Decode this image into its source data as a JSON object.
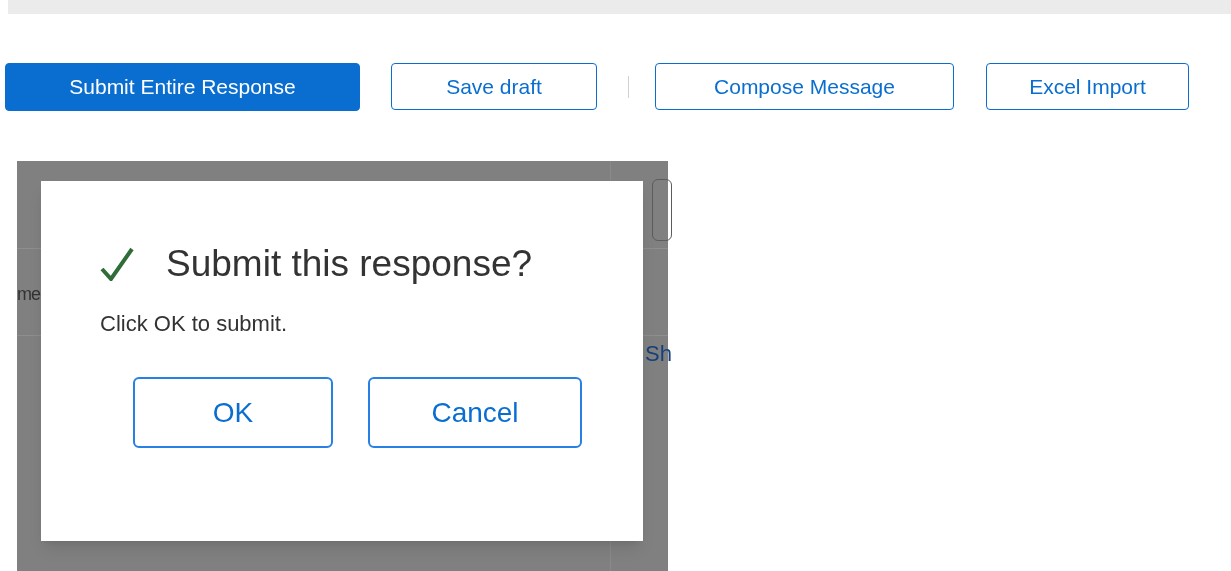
{
  "toolbar_buttons": [
    {
      "label": "Submit Entire Response",
      "kind": "primary"
    },
    {
      "label": "Save draft",
      "kind": "secondary"
    },
    {
      "label": "Compose Message",
      "kind": "secondary"
    },
    {
      "label": "Excel Import",
      "kind": "secondary"
    }
  ],
  "background_fragments": [
    "me",
    "Sh"
  ],
  "dialog": {
    "title": "Submit this response?",
    "message": "Click OK to submit.",
    "buttons": [
      "OK",
      "Cancel"
    ]
  }
}
